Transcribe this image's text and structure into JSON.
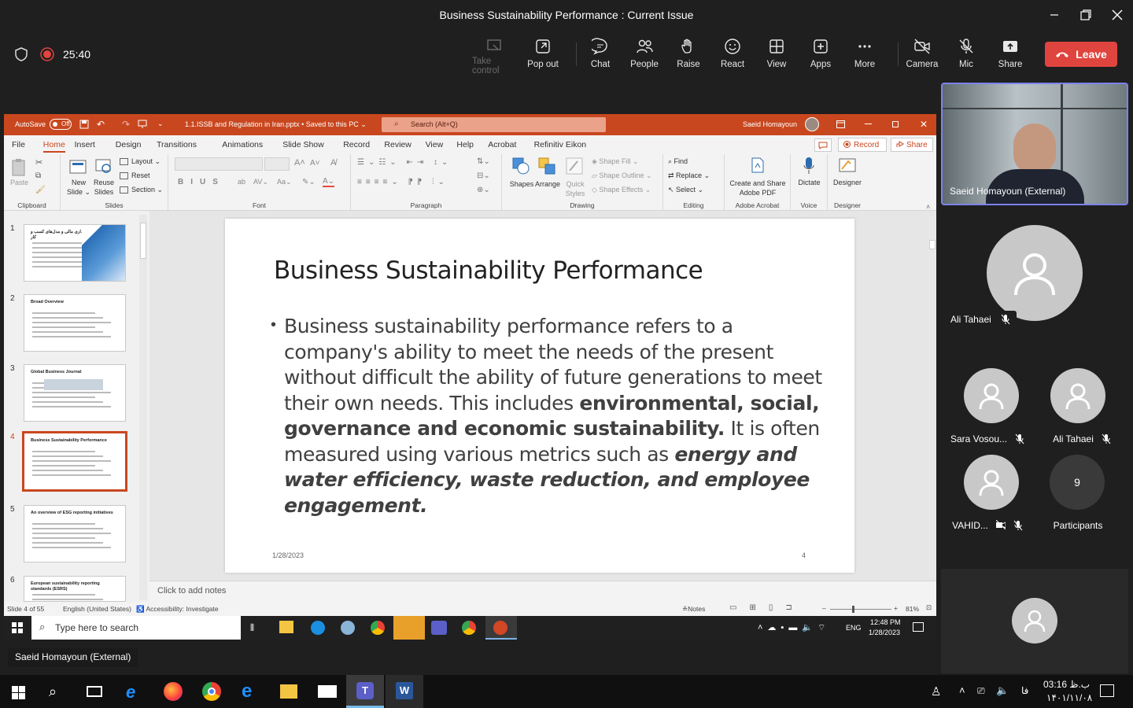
{
  "window": {
    "title": "Business Sustainability Performance : Current Issue"
  },
  "meeting": {
    "timer": "25:40",
    "toolbar": [
      {
        "label": "Take control",
        "icon": "take-control-icon",
        "enabled": false
      },
      {
        "label": "Pop out",
        "icon": "pop-out-icon",
        "enabled": true
      },
      {
        "label": "Chat",
        "icon": "chat-icon",
        "enabled": true
      },
      {
        "label": "People",
        "icon": "people-icon",
        "enabled": true
      },
      {
        "label": "Raise",
        "icon": "raise-hand-icon",
        "enabled": true
      },
      {
        "label": "React",
        "icon": "react-icon",
        "enabled": true
      },
      {
        "label": "View",
        "icon": "view-icon",
        "enabled": true
      },
      {
        "label": "Apps",
        "icon": "apps-icon",
        "enabled": true
      },
      {
        "label": "More",
        "icon": "more-icon",
        "enabled": true
      },
      {
        "label": "Camera",
        "icon": "camera-off-icon",
        "enabled": true
      },
      {
        "label": "Mic",
        "icon": "mic-off-icon",
        "enabled": true
      },
      {
        "label": "Share",
        "icon": "share-icon",
        "enabled": true
      }
    ],
    "leave_label": "Leave",
    "presenter_label": "Saeid Homayoun (External)"
  },
  "ppt": {
    "autosave_label": "AutoSave",
    "autosave_state": "Off",
    "file_title": "1.1.ISSB and Regulation in Iran.pptx • Saved to this PC ⌄",
    "search_placeholder": "Search (Alt+Q)",
    "user_name": "Saeid Homayoun",
    "menu": [
      "File",
      "Home",
      "Insert",
      "Design",
      "Transitions",
      "Animations",
      "Slide Show",
      "Record",
      "Review",
      "View",
      "Help",
      "Acrobat",
      "Refinitiv Eikon"
    ],
    "active_menu": "Home",
    "record_label": "Record",
    "share_label": "Share",
    "ribbon": {
      "clipboard": {
        "label": "Clipboard",
        "paste": "Paste"
      },
      "slides": {
        "label": "Slides",
        "new_slide": "New Slide ⌄",
        "reuse": "Reuse Slides",
        "layout": "Layout ⌄",
        "reset": "Reset",
        "section": "Section ⌄"
      },
      "font": {
        "label": "Font"
      },
      "paragraph": {
        "label": "Paragraph"
      },
      "drawing": {
        "label": "Drawing",
        "shapes": "Shapes",
        "arrange": "Arrange",
        "quick_styles": "Quick Styles ⌄",
        "shape_fill": "Shape Fill ⌄",
        "shape_outline": "Shape Outline ⌄",
        "shape_effects": "Shape Effects ⌄"
      },
      "editing": {
        "label": "Editing",
        "find": "Find",
        "replace": "Replace ⌄",
        "select": "Select ⌄"
      },
      "acrobat": {
        "label": "Adobe Acrobat",
        "create": "Create and Share Adobe PDF"
      },
      "voice": {
        "label": "Voice",
        "dictate": "Dictate"
      },
      "designer": {
        "label": "Designer",
        "designer": "Designer"
      }
    },
    "thumbnails": [
      {
        "num": "1",
        "title": "بیمه در قلمرو پایداری مالی و مدل‌های کسب و کار"
      },
      {
        "num": "2",
        "title": "Broad Overview"
      },
      {
        "num": "3",
        "title": "Global Business Journal"
      },
      {
        "num": "4",
        "title": "Business Sustainability Performance"
      },
      {
        "num": "5",
        "title": "An overview of ESG reporting initiatives"
      },
      {
        "num": "6",
        "title": "European sustainability reporting standards (ESRS)"
      }
    ],
    "slide": {
      "title": "Business Sustainability Performance",
      "body_part1": "Business sustainability performance refers to a company's ability to meet the needs of the present without difficult  the ability of future generations to meet their own needs. This includes ",
      "body_bold": "environmental, social, governance and economic sustainability.",
      "body_part2": " It is often measured using various metrics such as ",
      "body_bold_italic": "energy and water efficiency, waste reduction, and employee engagement.",
      "date": "1/28/2023",
      "number": "4"
    },
    "notes_placeholder": "Click to add notes",
    "status": {
      "slide": "Slide 4 of 55",
      "language": "English (United States)",
      "accessibility": "Accessibility: Investigate",
      "notes": "Notes",
      "zoom": "81%"
    },
    "taskbar": {
      "search_placeholder": "Type here to search",
      "lang": "ENG",
      "time": "12:48 PM",
      "date": "1/28/2023"
    }
  },
  "participants": {
    "video_name": "Saeid Homayoun (External)",
    "large": {
      "name": "Ali Tahaei"
    },
    "small": [
      {
        "name": "Sara Vosou..."
      },
      {
        "name": "Ali Tahaei"
      },
      {
        "name": "VAHID..."
      }
    ],
    "more_count": "9",
    "more_label": "Participants"
  },
  "system": {
    "time": "03:16 ب.ظ",
    "date": "۱۴۰۱/۱۱/۰۸",
    "lang": "فا"
  }
}
